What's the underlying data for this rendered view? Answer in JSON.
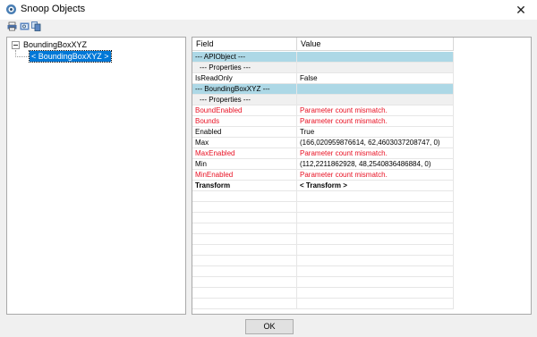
{
  "window": {
    "title": "Snoop Objects"
  },
  "tree": {
    "root_label": "BoundingBoxXYZ",
    "child_label": "< BoundingBoxXYZ >"
  },
  "grid": {
    "headers": {
      "field": "Field",
      "value": "Value"
    },
    "rows": [
      {
        "field": "--- APIObject ---",
        "value": ""
      },
      {
        "field": "--- Properties ---",
        "value": ""
      },
      {
        "field": "IsReadOnly",
        "value": "False"
      },
      {
        "field": "--- BoundingBoxXYZ ---",
        "value": ""
      },
      {
        "field": "--- Properties ---",
        "value": ""
      },
      {
        "field": "BoundEnabled",
        "value": "Parameter count mismatch."
      },
      {
        "field": "Bounds",
        "value": "Parameter count mismatch."
      },
      {
        "field": "Enabled",
        "value": "True"
      },
      {
        "field": "Max",
        "value": "(166,020959876614, 62,4603037208747, 0)"
      },
      {
        "field": "MaxEnabled",
        "value": "Parameter count mismatch."
      },
      {
        "field": "Min",
        "value": "(112,2211862928, 48,2540836486884, 0)"
      },
      {
        "field": "MinEnabled",
        "value": "Parameter count mismatch."
      },
      {
        "field": "Transform",
        "value": "< Transform >"
      }
    ]
  },
  "buttons": {
    "ok": "OK",
    "close": "✕"
  },
  "colors": {
    "section_bg": "#add8e6",
    "error_text": "#e81123",
    "selection_bg": "#0078d7"
  },
  "icons": {
    "app": "snoop-icon",
    "toolbar": [
      "print-icon",
      "print-preview-icon",
      "copy-icon"
    ]
  }
}
